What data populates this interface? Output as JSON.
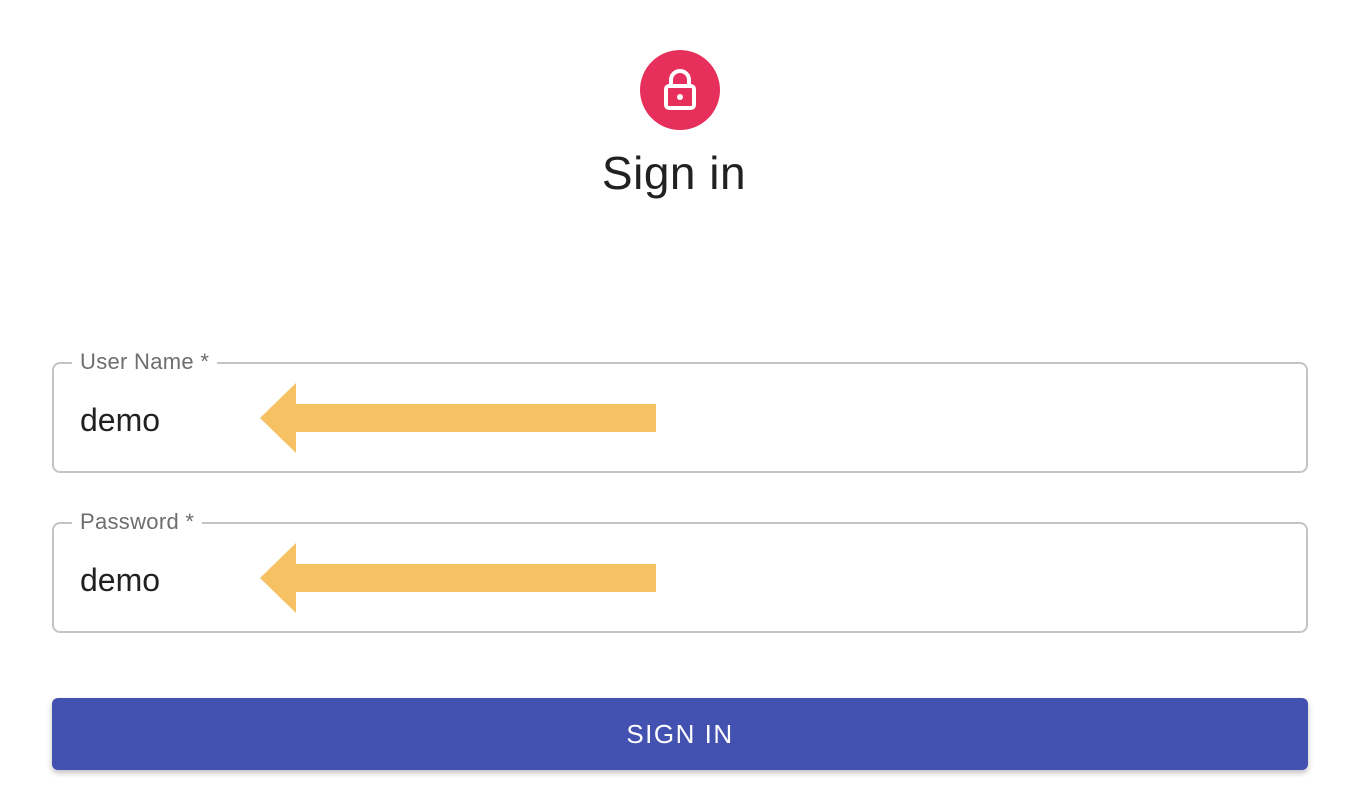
{
  "header": {
    "icon": "lock-icon",
    "title": "Sign in"
  },
  "form": {
    "username": {
      "label": "User Name *",
      "value": "demo"
    },
    "password": {
      "label": "Password *",
      "value": "demo"
    },
    "submit_label": "SIGN IN"
  },
  "annotations": {
    "arrow_color": "#f6c163",
    "arrow_icon": "left-arrow-icon"
  },
  "colors": {
    "avatar": "#e6305b",
    "primary": "#4352b0"
  }
}
